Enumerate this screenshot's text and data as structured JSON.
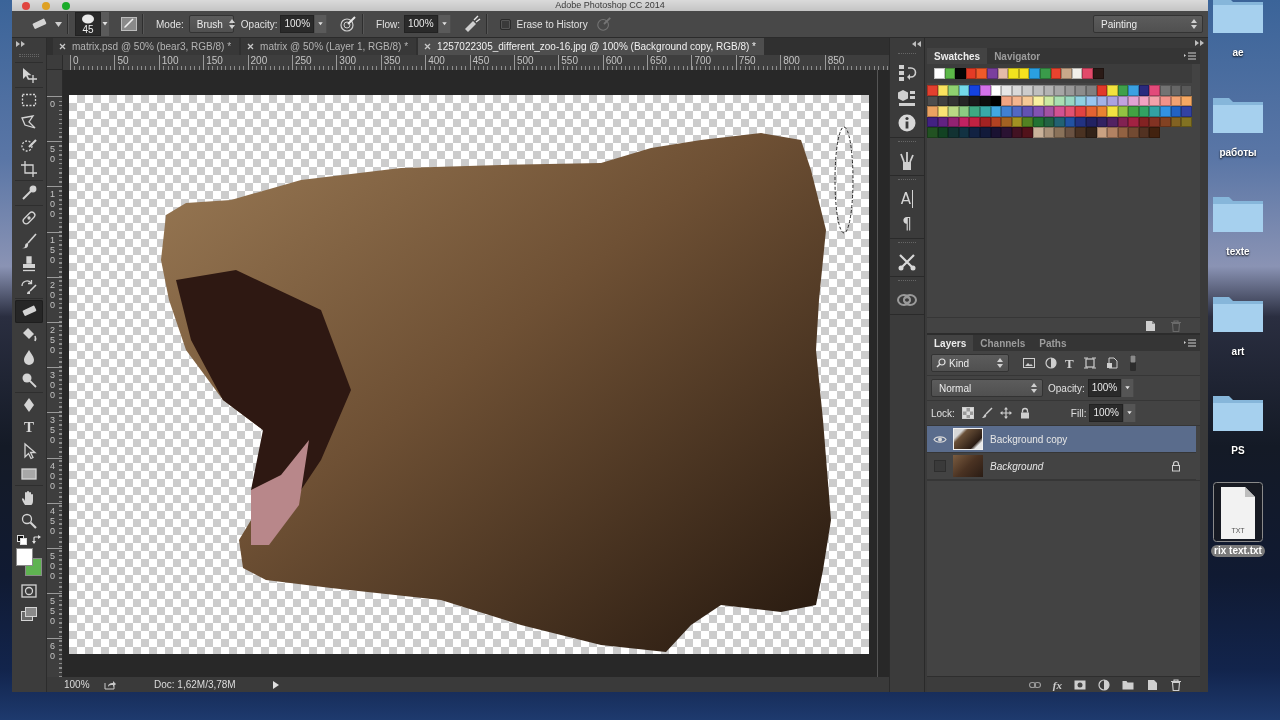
{
  "window": {
    "title": "Adobe Photoshop CC 2014"
  },
  "options_bar": {
    "brush_size": "45",
    "mode_label": "Mode:",
    "mode": "Brush",
    "opacity_label": "Opacity:",
    "opacity": "100%",
    "flow_label": "Flow:",
    "flow": "100%",
    "erase_to_history": {
      "label": "Erase to History",
      "checked": false
    },
    "workspace": "Painting"
  },
  "document_tabs": [
    {
      "title": "matrix.psd @ 50% (bear3, RGB/8) *",
      "selected": false
    },
    {
      "title": "matrix @ 50% (Layer 1, RGB/8) *",
      "selected": false
    },
    {
      "title": "1257022305_different_zoo-16.jpg @ 100% (Background copy, RGB/8) *",
      "selected": true
    }
  ],
  "toolbar": {
    "groups": [
      {
        "tools": [
          {
            "kind": "move",
            "selected": false
          }
        ]
      },
      {
        "tools": [
          {
            "kind": "marquee",
            "selected": false
          },
          {
            "kind": "lasso",
            "selected": false
          },
          {
            "kind": "quick-selection",
            "selected": false
          },
          {
            "kind": "crop",
            "selected": false
          }
        ]
      },
      {
        "tools": [
          {
            "kind": "eyedropper",
            "selected": false
          }
        ]
      },
      {
        "tools": [
          {
            "kind": "healing",
            "selected": false
          },
          {
            "kind": "brush",
            "selected": false
          },
          {
            "kind": "stamp",
            "selected": false
          },
          {
            "kind": "history-brush",
            "selected": false
          }
        ]
      },
      {
        "tools": [
          {
            "kind": "eraser",
            "selected": true
          },
          {
            "kind": "bucket",
            "selected": false
          },
          {
            "kind": "blur",
            "selected": false
          },
          {
            "kind": "dodge",
            "selected": false
          }
        ]
      },
      {
        "tools": [
          {
            "kind": "pen",
            "selected": false
          },
          {
            "kind": "type",
            "glyph": "T",
            "selected": false
          },
          {
            "kind": "path-selection",
            "selected": false
          },
          {
            "kind": "rectangle",
            "selected": false
          }
        ]
      },
      {
        "tools": [
          {
            "kind": "hand",
            "selected": false
          },
          {
            "kind": "zoom",
            "selected": false
          }
        ]
      }
    ],
    "color_swatches": [
      {
        "color": "#ffffff"
      },
      {
        "color": "#5fb351"
      }
    ]
  },
  "rulers": {
    "horizontal": [
      "0",
      "50",
      "100",
      "150",
      "200",
      "250",
      "300",
      "350",
      "400",
      "450",
      "500",
      "550",
      "600",
      "650",
      "700",
      "750",
      "800",
      "850"
    ],
    "vertical": [
      "0",
      "50",
      "100",
      "150",
      "200",
      "250",
      "300",
      "350",
      "400",
      "450",
      "500",
      "550",
      "60"
    ]
  },
  "status_bar": {
    "zoom": "100%",
    "doc_info": "Doc: 1,62M/3,78M"
  },
  "panel_dock": {
    "groups": [
      {
        "items": [
          {
            "kind": "history"
          },
          {
            "kind": "properties"
          },
          {
            "kind": "info"
          }
        ]
      },
      {
        "items": [
          {
            "kind": "brush-presets"
          }
        ]
      },
      {
        "items": [
          {
            "kind": "character",
            "glyph": "A"
          },
          {
            "kind": "paragraph",
            "glyph": "¶"
          }
        ]
      },
      {
        "items": [
          {
            "kind": "tools"
          }
        ]
      },
      {
        "items": [
          {
            "kind": "libraries"
          }
        ]
      }
    ]
  },
  "swatches_panel": {
    "tabs": [
      {
        "label": "Swatches",
        "selected": true
      },
      {
        "label": "Navigator",
        "selected": false
      }
    ],
    "recent": [
      {
        "color": "#ffffff"
      },
      {
        "color": "#5cb848"
      },
      {
        "color": "#050505"
      },
      {
        "color": "#e33b26"
      },
      {
        "color": "#ee5a2a"
      },
      {
        "color": "#7a3f9e"
      },
      {
        "color": "#e4bba8"
      },
      {
        "color": "#f2e41e"
      },
      {
        "color": "#f5e21e"
      },
      {
        "color": "#2a9fe2"
      },
      {
        "color": "#3a9b4a"
      },
      {
        "color": "#e9432e"
      },
      {
        "color": "#c9a98a"
      },
      {
        "color": "#f2f0ea"
      },
      {
        "color": "#e34a6a"
      },
      {
        "color": "#2a1a16"
      }
    ],
    "rows": [
      {
        "swatches": [
          {
            "color": "#e23f2e"
          },
          {
            "color": "#f9e25e"
          },
          {
            "color": "#8fd170"
          },
          {
            "color": "#73d9ea"
          },
          {
            "color": "#1442e0"
          },
          {
            "color": "#d571ea"
          },
          {
            "color": "#ffffff"
          },
          {
            "color": "#e6e6e6"
          },
          {
            "color": "#d9d9d9"
          },
          {
            "color": "#cccccc"
          },
          {
            "color": "#bfbfbf"
          },
          {
            "color": "#b3b3b3"
          },
          {
            "color": "#a6a6a6"
          },
          {
            "color": "#999999"
          },
          {
            "color": "#8c8c8c"
          },
          {
            "color": "#808080"
          },
          {
            "color": "#e2392a"
          },
          {
            "color": "#f2e23e"
          },
          {
            "color": "#3fa04a"
          },
          {
            "color": "#3aa1e2"
          },
          {
            "color": "#2a2a7e"
          },
          {
            "color": "#e24a7a"
          },
          {
            "color": "#737373"
          },
          {
            "color": "#666666"
          },
          {
            "color": "#595959"
          }
        ]
      },
      {
        "swatches": [
          {
            "color": "#4d4d4d"
          },
          {
            "color": "#404040"
          },
          {
            "color": "#333333"
          },
          {
            "color": "#262626"
          },
          {
            "color": "#1a1a1a"
          },
          {
            "color": "#0d0d0d"
          },
          {
            "color": "#000000"
          },
          {
            "color": "#f2a482"
          },
          {
            "color": "#f4b58e"
          },
          {
            "color": "#f6c996"
          },
          {
            "color": "#f9f0a0"
          },
          {
            "color": "#cde9a2"
          },
          {
            "color": "#aadfb2"
          },
          {
            "color": "#98d8c2"
          },
          {
            "color": "#8ed0e2"
          },
          {
            "color": "#98c6f0"
          },
          {
            "color": "#a2b2e8"
          },
          {
            "color": "#aaa2e0"
          },
          {
            "color": "#c2a2e0"
          },
          {
            "color": "#e2a2d2"
          },
          {
            "color": "#f2a2c2"
          },
          {
            "color": "#f2a2aa"
          },
          {
            "color": "#f2928a"
          },
          {
            "color": "#f2a272"
          },
          {
            "color": "#f6a862"
          }
        ]
      },
      {
        "swatches": [
          {
            "color": "#eaa261"
          },
          {
            "color": "#f9e374"
          },
          {
            "color": "#bad984"
          },
          {
            "color": "#8ccb82"
          },
          {
            "color": "#3fa982"
          },
          {
            "color": "#38a9a8"
          },
          {
            "color": "#41a8e2"
          },
          {
            "color": "#4180d2"
          },
          {
            "color": "#5268c2"
          },
          {
            "color": "#6252b2"
          },
          {
            "color": "#8252b2"
          },
          {
            "color": "#a252a2"
          },
          {
            "color": "#d25292"
          },
          {
            "color": "#e25272"
          },
          {
            "color": "#e24242"
          },
          {
            "color": "#e46232"
          },
          {
            "color": "#ea8232"
          },
          {
            "color": "#f2e242"
          },
          {
            "color": "#92c242"
          },
          {
            "color": "#42a242"
          },
          {
            "color": "#32a262"
          },
          {
            "color": "#32a2a2"
          },
          {
            "color": "#3292e2"
          },
          {
            "color": "#2262c2"
          },
          {
            "color": "#3242a2"
          }
        ]
      },
      {
        "swatches": [
          {
            "color": "#422282"
          },
          {
            "color": "#622282"
          },
          {
            "color": "#922272"
          },
          {
            "color": "#c22262"
          },
          {
            "color": "#c22242"
          },
          {
            "color": "#a22222"
          },
          {
            "color": "#b24222"
          },
          {
            "color": "#a26222"
          },
          {
            "color": "#a29222"
          },
          {
            "color": "#528222"
          },
          {
            "color": "#227232"
          },
          {
            "color": "#226242"
          },
          {
            "color": "#226272"
          },
          {
            "color": "#2252a2"
          },
          {
            "color": "#223282"
          },
          {
            "color": "#222262"
          },
          {
            "color": "#322262"
          },
          {
            "color": "#522262"
          },
          {
            "color": "#822252"
          },
          {
            "color": "#a22242"
          },
          {
            "color": "#822222"
          },
          {
            "color": "#823222"
          },
          {
            "color": "#824222"
          },
          {
            "color": "#826222"
          },
          {
            "color": "#827222"
          }
        ]
      },
      {
        "swatches": [
          {
            "color": "#225222"
          },
          {
            "color": "#124222"
          },
          {
            "color": "#123232"
          },
          {
            "color": "#123242"
          },
          {
            "color": "#122242"
          },
          {
            "color": "#121a3a"
          },
          {
            "color": "#1a1232"
          },
          {
            "color": "#2a1232"
          },
          {
            "color": "#421222"
          },
          {
            "color": "#52121a"
          },
          {
            "color": "#cab29a"
          },
          {
            "color": "#aa927a"
          },
          {
            "color": "#8a725a"
          },
          {
            "color": "#6a5242"
          },
          {
            "color": "#4a3222"
          },
          {
            "color": "#322218"
          },
          {
            "color": "#caa282"
          },
          {
            "color": "#b28262"
          },
          {
            "color": "#926242"
          },
          {
            "color": "#724a32"
          },
          {
            "color": "#523222"
          },
          {
            "color": "#42220f"
          }
        ]
      }
    ]
  },
  "layers_panel": {
    "tabs": [
      {
        "label": "Layers",
        "selected": true
      },
      {
        "label": "Channels",
        "selected": false
      },
      {
        "label": "Paths",
        "selected": false
      }
    ],
    "filter": {
      "label": "Kind",
      "icons": [
        {
          "kind": "pixel"
        },
        {
          "kind": "adjustment"
        },
        {
          "kind": "type",
          "glyph": "T"
        },
        {
          "kind": "shape"
        },
        {
          "kind": "smart-object"
        }
      ],
      "switch_on": false
    },
    "blend_mode": "Normal",
    "opacity_label": "Opacity:",
    "opacity": "100%",
    "lock_label": "Lock:",
    "fill_label": "Fill:",
    "fill": "100%",
    "layers": [
      {
        "name": "Background copy",
        "visible": true,
        "selected": true,
        "locked": false
      },
      {
        "name": "Background",
        "visible": false,
        "selected": false,
        "locked": true
      }
    ],
    "footer": [
      {
        "kind": "link"
      },
      {
        "kind": "fx",
        "glyph": "fx"
      },
      {
        "kind": "mask"
      },
      {
        "kind": "adjustment"
      },
      {
        "kind": "group"
      },
      {
        "kind": "new"
      },
      {
        "kind": "delete"
      }
    ]
  },
  "desktop": {
    "items": [
      {
        "kind": "folder",
        "label": "ae",
        "selected": false
      },
      {
        "kind": "folder",
        "label": "работы",
        "selected": false
      },
      {
        "kind": "folder",
        "label": "texte",
        "selected": false
      },
      {
        "kind": "folder",
        "label": "art",
        "selected": false
      },
      {
        "kind": "folder",
        "label": "PS",
        "selected": false
      },
      {
        "kind": "file",
        "label": "rix text.txt",
        "badge": "TXT",
        "selected": true
      }
    ]
  }
}
